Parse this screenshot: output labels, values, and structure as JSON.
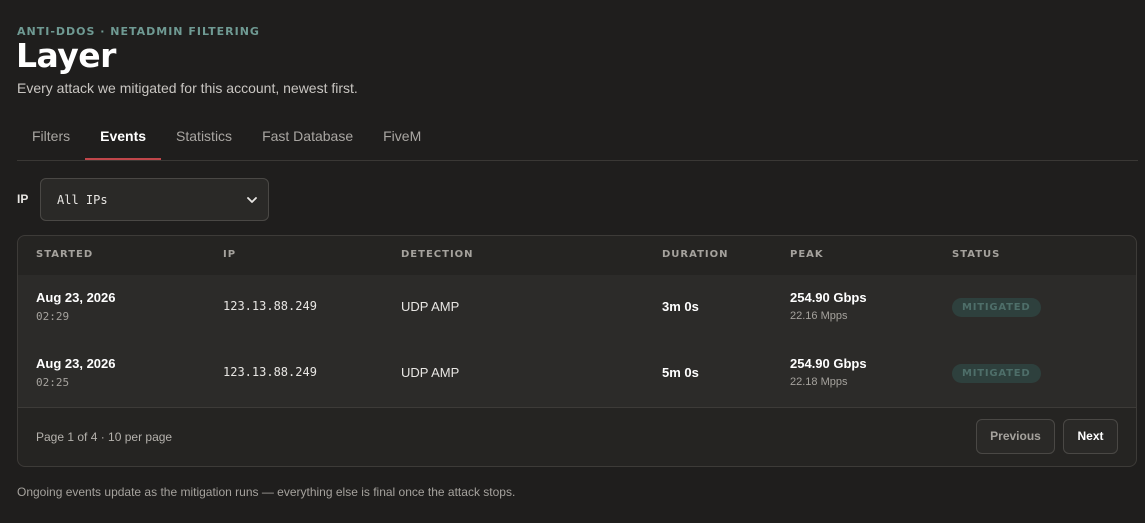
{
  "header": {
    "eyebrow": "ANTI-DDOS · NETADMIN FILTERING",
    "title": "Layer",
    "subtitle": "Every attack we mitigated for this account, newest first."
  },
  "tabs": [
    {
      "label": "Filters",
      "active": false
    },
    {
      "label": "Events",
      "active": true
    },
    {
      "label": "Statistics",
      "active": false
    },
    {
      "label": "Fast Database",
      "active": false
    },
    {
      "label": "FiveM",
      "active": false
    }
  ],
  "filter": {
    "label": "IP",
    "selected": "All IPs"
  },
  "table": {
    "columns": [
      "STARTED",
      "IP",
      "DETECTION",
      "DURATION",
      "PEAK",
      "STATUS"
    ],
    "rows": [
      {
        "date": "Aug 23, 2026",
        "time": "02:29",
        "ip": "123.13.88.249",
        "detection": "UDP AMP",
        "duration": "3m 0s",
        "peak": "254.90 Gbps",
        "pps": "22.16 Mpps",
        "status": "MITIGATED"
      },
      {
        "date": "Aug 23, 2026",
        "time": "02:25",
        "ip": "123.13.88.249",
        "detection": "UDP AMP",
        "duration": "5m 0s",
        "peak": "254.90 Gbps",
        "pps": "22.18 Mpps",
        "status": "MITIGATED"
      }
    ]
  },
  "pagination": {
    "info": "Page 1 of 4 · 10 per page",
    "prev_label": "Previous",
    "next_label": "Next"
  },
  "footer_note": "Ongoing events update as the mitigation runs — everything else is final once the attack stops.",
  "colors": {
    "accent_tab": "#c0464a",
    "eyebrow": "#6f9a93",
    "badge_bg": "#2e403d",
    "badge_text": "#4e6e69"
  }
}
